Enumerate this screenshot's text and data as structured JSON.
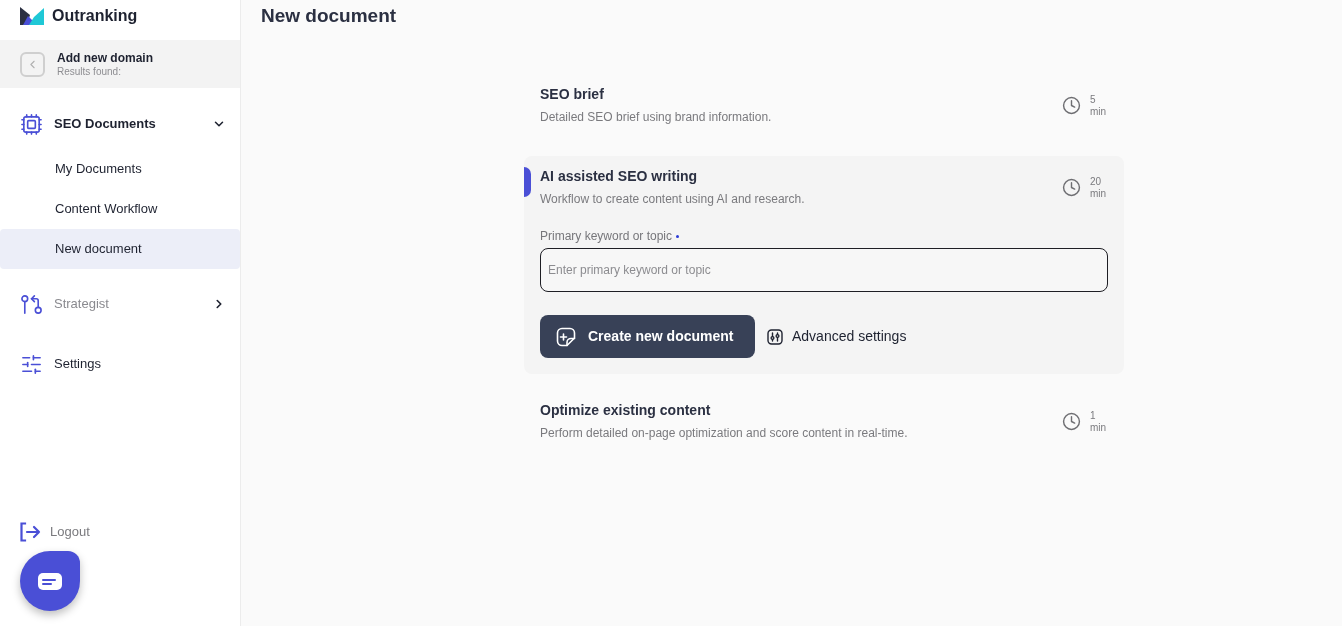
{
  "sidebar": {
    "brand": "Outranking",
    "domain": {
      "title": "Add new domain",
      "subtitle": "Results found:"
    },
    "nav": [
      {
        "kind": "group",
        "label": "SEO Documents",
        "expanded": true,
        "disabled": false,
        "children": [
          {
            "label": "My Documents",
            "selected": false
          },
          {
            "label": "Content Workflow",
            "selected": false
          },
          {
            "label": "New document",
            "selected": true
          }
        ]
      },
      {
        "kind": "group",
        "label": "Strategist",
        "expanded": false,
        "disabled": true
      },
      {
        "kind": "link",
        "label": "Settings",
        "disabled": false
      }
    ],
    "logout": "Logout"
  },
  "main": {
    "title": "New document",
    "options": [
      {
        "title": "SEO brief",
        "description": "Detailed SEO brief using brand information.",
        "duration": "5",
        "unit": "min",
        "selected": false
      },
      {
        "title": "AI assisted SEO writing",
        "description": "Workflow to create content using AI and research.",
        "duration": "20",
        "unit": "min",
        "selected": true,
        "form": {
          "label": "Primary keyword or topic",
          "required": true,
          "placeholder": "Enter primary keyword or topic",
          "submit": "Create new document",
          "settings": "Advanced settings"
        }
      },
      {
        "title": "Optimize existing content",
        "description": "Perform detailed on-page optimization and score content in real-time.",
        "duration": "1",
        "unit": "min",
        "selected": false
      }
    ]
  }
}
